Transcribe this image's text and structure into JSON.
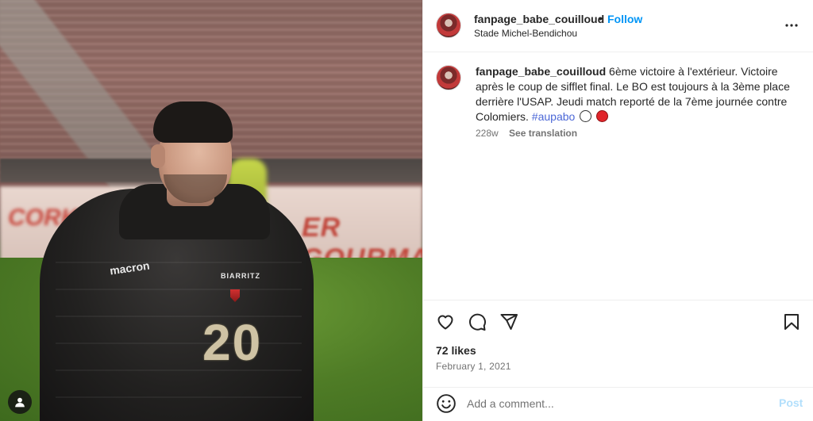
{
  "post": {
    "username": "fanpage_babe_couilloud",
    "follow_label": "Follow",
    "separator": "•",
    "location": "Stade Michel-Bendichou",
    "more_icon": "more-horizontal-icon"
  },
  "photo": {
    "jersey_number": "20",
    "sponsor_text": "macron",
    "club_text": "BIARRITZ",
    "board_text": "ER GOURMA",
    "board_text_left": "CORKIS",
    "user_tag_icon": "person-icon"
  },
  "caption": {
    "username": "fanpage_babe_couilloud",
    "text": "6ème victoire à l'extérieur. Victoire après le coup de sifflet final. Le BO est toujours à la 3ème place derrière l'USAP. Jeudi match reporté de la 7ème journée contre Colomiers.",
    "hashtag": "#aupabo",
    "age": "228w",
    "see_translation": "See translation"
  },
  "actions": {
    "icons": [
      "heart-icon",
      "comment-icon",
      "share-icon",
      "bookmark-icon"
    ],
    "likes": "72 likes",
    "date": "February 1, 2021"
  },
  "comment": {
    "placeholder": "Add a comment...",
    "post_label": "Post",
    "emoji_icon": "smiley-icon"
  },
  "colors": {
    "accent": "#0095f6",
    "post_disabled": "#b2dffc",
    "hashtag": "#4c68d7",
    "secondary_text": "#737373"
  }
}
